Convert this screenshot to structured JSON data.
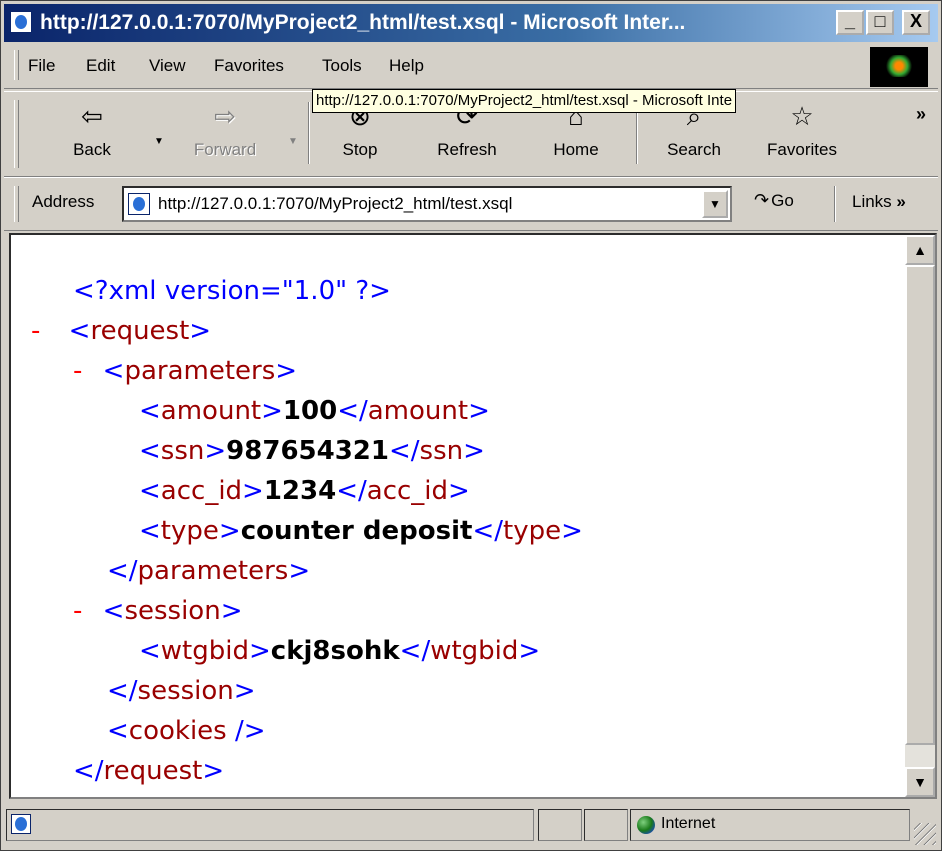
{
  "window": {
    "title": "http://127.0.0.1:7070/MyProject2_html/test.xsql - Microsoft Inter...",
    "controls": {
      "minimize": "_",
      "maximize": "□",
      "close": "X"
    }
  },
  "menu": {
    "items": [
      "File",
      "Edit",
      "View",
      "Favorites",
      "Tools",
      "Help"
    ]
  },
  "tooltip": "http://127.0.0.1:7070/MyProject2_html/test.xsql - Microsoft Inte",
  "toolbar": {
    "back": "Back",
    "forward": "Forward",
    "stop": "Stop",
    "refresh": "Refresh",
    "home": "Home",
    "search": "Search",
    "favorites": "Favorites",
    "overflow": "»"
  },
  "address": {
    "label": "Address",
    "url": "http://127.0.0.1:7070/MyProject2_html/test.xsql",
    "go": "Go",
    "links": "Links",
    "links_overflow": "»"
  },
  "xml": {
    "declaration": "<?xml version=\"1.0\" ?>",
    "collapse_marker": "-",
    "request": "request",
    "parameters": "parameters",
    "amount_tag": "amount",
    "amount": "100",
    "ssn_tag": "ssn",
    "ssn": "987654321",
    "acc_id_tag": "acc_id",
    "acc_id": "1234",
    "type_tag": "type",
    "type": "counter deposit",
    "session": "session",
    "wtgbid_tag": "wtgbid",
    "wtgbid": "ckj8sohk",
    "cookies": "cookies"
  },
  "status": {
    "zone": "Internet"
  }
}
